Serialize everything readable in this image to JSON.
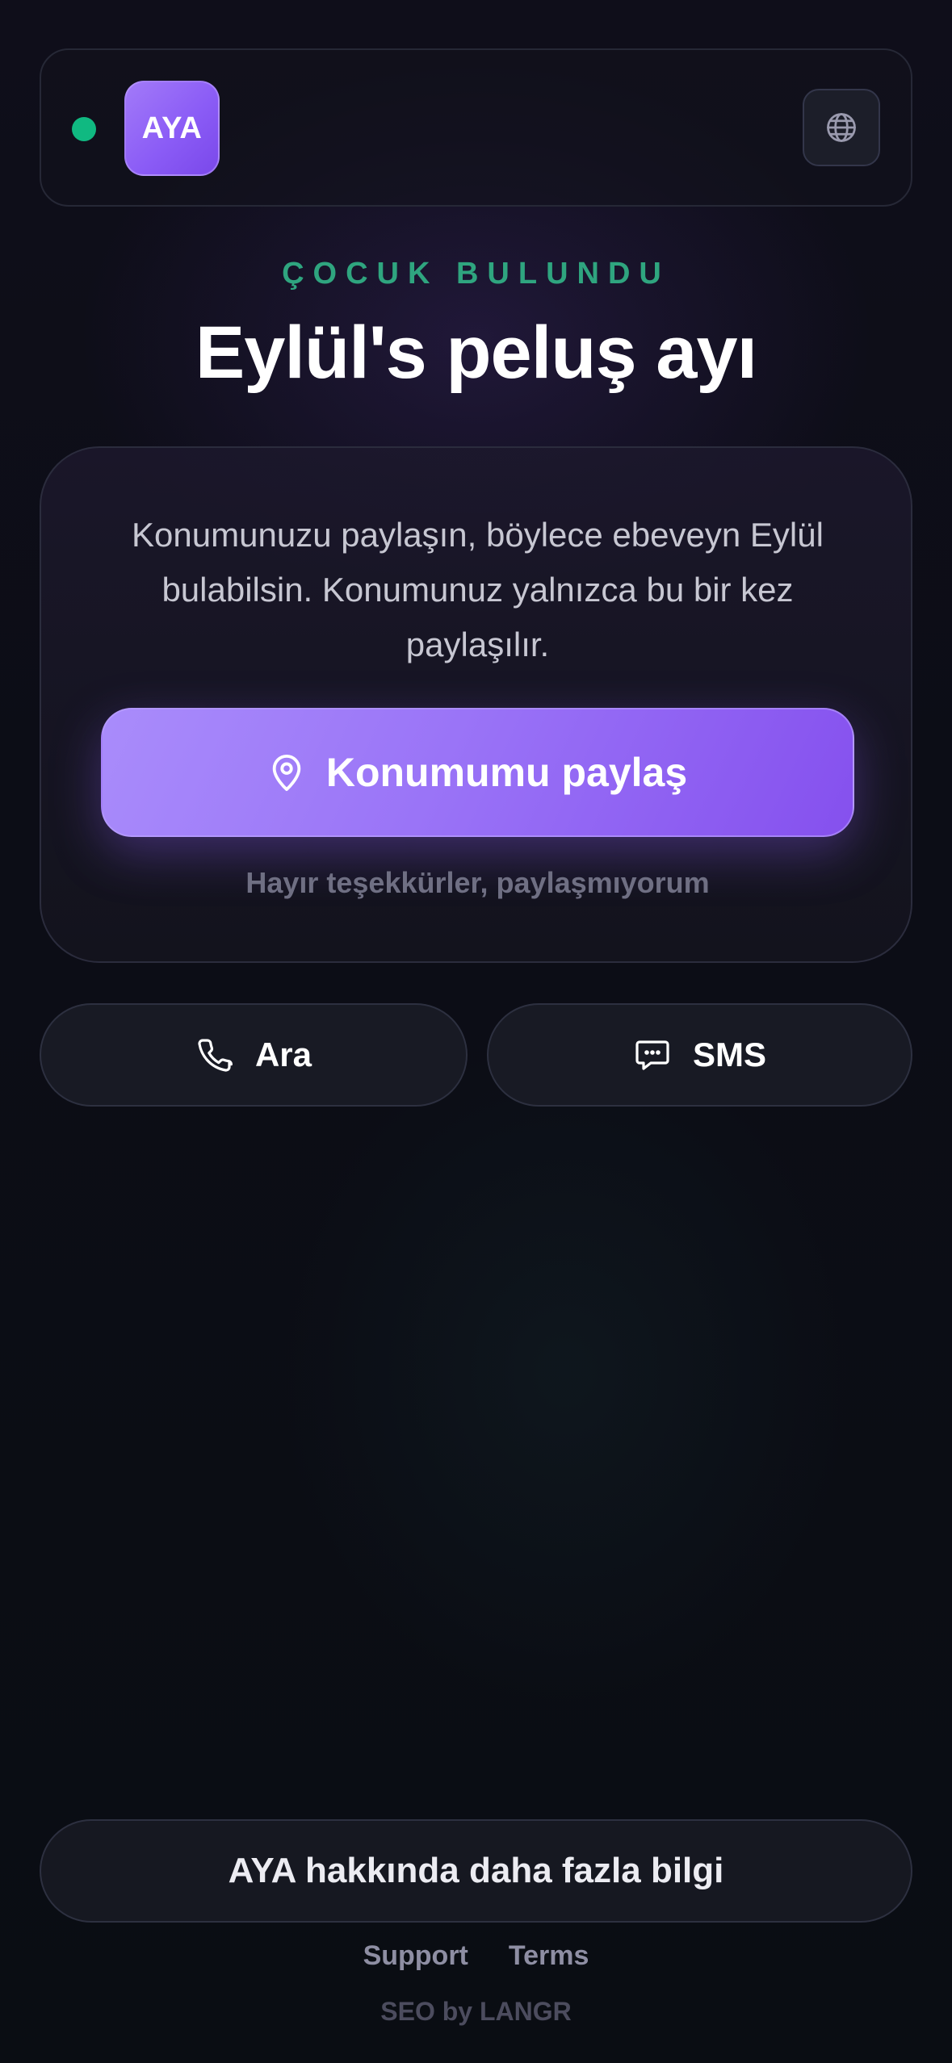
{
  "header": {
    "logo_text": "AYA",
    "status_color": "#10b981",
    "language_icon": "globe-icon"
  },
  "eyebrow": "ÇOCUK BULUNDU",
  "title": "Eylül's peluş ayı",
  "card": {
    "message": "Konumunuzu paylaşın, böylece ebeveyn Eylül bulabilsin. Konumunuz yalnızca bu bir kez paylaşılır.",
    "share_button_label": "Konumumu paylaş",
    "share_button_icon": "location-pin-icon",
    "decline_label": "Hayır teşekkürler, paylaşmıyorum"
  },
  "contact": {
    "call_label": "Ara",
    "call_icon": "phone-icon",
    "sms_label": "SMS",
    "sms_icon": "message-icon"
  },
  "more_info_label": "AYA hakkında daha fazla bilgi",
  "footer": {
    "links": [
      "Support",
      "Terms"
    ],
    "credit": "SEO by LANGR"
  },
  "colors": {
    "accent": "#8b5cf6",
    "eyebrow": "#2fa57f",
    "status": "#10b981"
  }
}
